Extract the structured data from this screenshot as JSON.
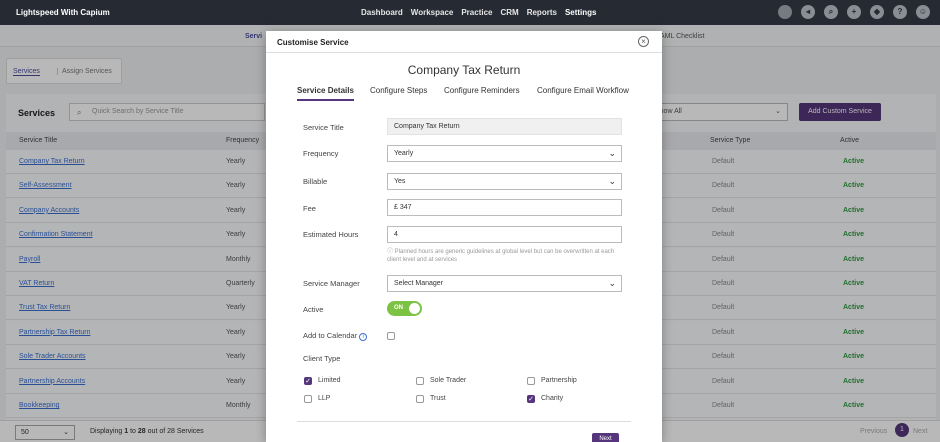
{
  "app": {
    "brand": "Lightspeed With Capium"
  },
  "nav": {
    "items": [
      "Dashboard",
      "Workspace",
      "Practice",
      "CRM",
      "Reports",
      "Settings"
    ],
    "active": "Settings"
  },
  "bg_tabs": {
    "services_partial": "Servi",
    "checklist_partial": "AML Checklist"
  },
  "subtabs": {
    "services": "Services",
    "assign": "Assign Services"
  },
  "services_panel": {
    "title": "Services",
    "search_placeholder": "Quick Search by Service Title",
    "filter_value": "Show All",
    "add_button": "Add Custom Service",
    "columns": {
      "title": "Service Title",
      "frequency": "Frequency",
      "type": "Service Type",
      "active": "Active"
    },
    "rows": [
      {
        "title": "Company Tax Return",
        "frequency": "Yearly",
        "type": "Default",
        "active": "Active"
      },
      {
        "title": "Self-Assessment",
        "frequency": "Yearly",
        "type": "Default",
        "active": "Active"
      },
      {
        "title": "Company Accounts",
        "frequency": "Yearly",
        "type": "Default",
        "active": "Active"
      },
      {
        "title": "Confirmation Statement",
        "frequency": "Yearly",
        "type": "Default",
        "active": "Active"
      },
      {
        "title": "Payroll",
        "frequency": "Monthly",
        "type": "Default",
        "active": "Active"
      },
      {
        "title": "VAT Return",
        "frequency": "Quarterly",
        "type": "Default",
        "active": "Active"
      },
      {
        "title": "Trust Tax Return",
        "frequency": "Yearly",
        "type": "Default",
        "active": "Active"
      },
      {
        "title": "Partnership Tax Return",
        "frequency": "Yearly",
        "type": "Default",
        "active": "Active"
      },
      {
        "title": "Sole Trader Accounts",
        "frequency": "Yearly",
        "type": "Default",
        "active": "Active"
      },
      {
        "title": "Partnership Accounts",
        "frequency": "Yearly",
        "type": "Default",
        "active": "Active"
      },
      {
        "title": "Bookkeeping",
        "frequency": "Monthly",
        "type": "Default",
        "active": "Active"
      }
    ]
  },
  "footer": {
    "page_size": "50",
    "displaying_prefix": "Displaying",
    "from": "1",
    "to_word": "to",
    "to": "28",
    "suffix": "out of 28 Services",
    "prev": "Previous",
    "next": "Next",
    "page": "1"
  },
  "modal": {
    "title": "Customise Service",
    "service_name": "Company Tax Return",
    "tabs": [
      "Service Details",
      "Configure Steps",
      "Configure Reminders",
      "Configure Email Workflow"
    ],
    "fields": {
      "service_title": {
        "label": "Service Title",
        "value": "Company Tax Return"
      },
      "frequency": {
        "label": "Frequency",
        "value": "Yearly"
      },
      "billable": {
        "label": "Billable",
        "value": "Yes"
      },
      "fee": {
        "label": "Fee",
        "value": "£ 347"
      },
      "estimated_hours": {
        "label": "Estimated Hours",
        "value": "4"
      },
      "hours_hint": "Planned hours are generic guidelines at global level but can be overwritten at each client level and at services",
      "service_manager": {
        "label": "Service Manager",
        "value": "Select Manager"
      },
      "active": {
        "label": "Active",
        "value": "ON"
      },
      "add_to_calendar": {
        "label": "Add to Calendar"
      },
      "client_type": {
        "label": "Client Type"
      }
    },
    "client_types": [
      {
        "label": "Limited",
        "checked": true
      },
      {
        "label": "Sole Trader",
        "checked": false
      },
      {
        "label": "Partnership",
        "checked": false
      },
      {
        "label": "LLP",
        "checked": false
      },
      {
        "label": "Trust",
        "checked": false
      },
      {
        "label": "Charity",
        "checked": true
      }
    ],
    "next_button": "Next"
  },
  "colors": {
    "accent": "#55367c",
    "active_green": "#2d9b3f",
    "toggle_green": "#7cc243",
    "link_blue": "#3a6fd1"
  }
}
